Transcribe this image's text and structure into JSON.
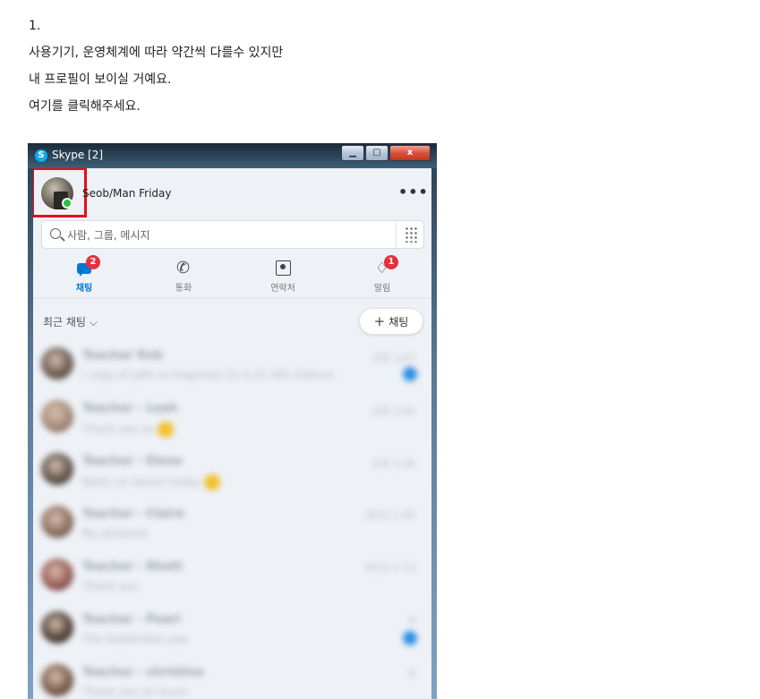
{
  "instructions": {
    "lines": [
      "1.",
      "사용기기, 운영체계에 따라 약간씩 다를수 있지만",
      "내 프로필이 보이실 거예요.",
      "여기를 클릭해주세요."
    ]
  },
  "window": {
    "title": "Skype [2]",
    "logo_letter": "S",
    "minimize": "▁",
    "maximize": "▢",
    "close": "x"
  },
  "profile": {
    "name": "Seob/Man Friday",
    "status": "online",
    "more_glyph": "•••"
  },
  "search": {
    "placeholder": "사람, 그룹, 메시지"
  },
  "tabs": [
    {
      "label": "채팅",
      "badge": "2",
      "icon": "chat-icon",
      "active": true
    },
    {
      "label": "통화",
      "badge": "",
      "icon": "phone-icon",
      "active": false
    },
    {
      "label": "연락처",
      "badge": "",
      "icon": "contacts-icon",
      "active": false
    },
    {
      "label": "알림",
      "badge": "1",
      "icon": "bell-icon",
      "active": false
    }
  ],
  "recent": {
    "header": "최근 채팅 ⌵",
    "new_chat_plus": "+",
    "new_chat_label": "채팅"
  },
  "chats": [
    {
      "name": "Teacher Rob",
      "preview": "I copy of pdfs or fragment 21 0.22 365 Ordnun",
      "time": "오후 3:07",
      "unread": true,
      "emoji": false,
      "avatar_color": "#6a5a50"
    },
    {
      "name": "Teacher - Leah",
      "preview": "Thank you so",
      "time": "오후 2:05",
      "unread": false,
      "emoji": true,
      "avatar_color": "#a78c7a"
    },
    {
      "name": "Teacher - Elena",
      "preview": "Bests on lesson today",
      "time": "오후 1:06",
      "unread": false,
      "emoji": true,
      "avatar_color": "#5e5248"
    },
    {
      "name": "Teacher - Claire",
      "preview": "My pleasure",
      "time": "2021-1-05",
      "unread": false,
      "emoji": false,
      "avatar_color": "#8c6e60"
    },
    {
      "name": "Teacher - Rhett",
      "preview": "Thank you",
      "time": "2021-1-13",
      "unread": false,
      "emoji": false,
      "avatar_color": "#9a5a56"
    },
    {
      "name": "Teacher - Pearl",
      "preview": "The September pay",
      "time": "8",
      "unread": true,
      "emoji": false,
      "avatar_color": "#4d4038"
    },
    {
      "name": "Teacher - christine",
      "preview": "Thank you so much",
      "time": "8",
      "unread": false,
      "emoji": false,
      "avatar_color": "#7b5b4c"
    }
  ],
  "colors": {
    "accent": "#0078d4",
    "badge": "#e5313c",
    "online": "#2bc04a",
    "highlight": "#e3101a"
  }
}
